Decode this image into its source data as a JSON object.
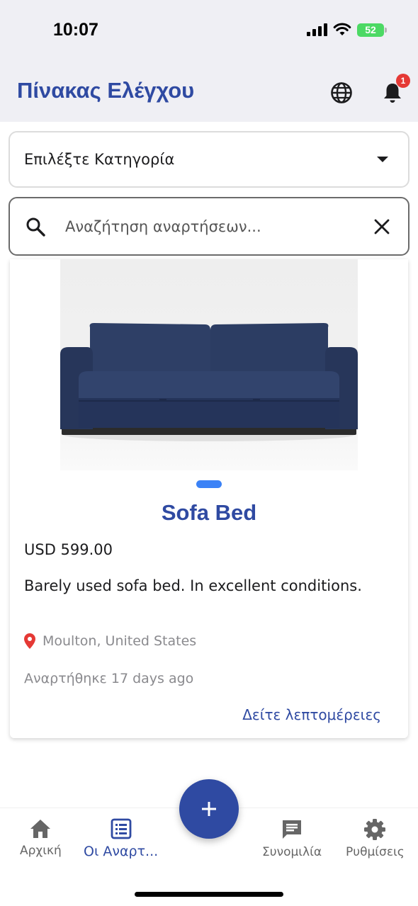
{
  "status_bar": {
    "time": "10:07",
    "battery": "52"
  },
  "header": {
    "title": "Πίνακας Ελέγχου",
    "notification_count": "1"
  },
  "filters": {
    "category_placeholder": "Επιλέξτε Κατηγορία",
    "search_placeholder": "Αναζήτηση αναρτήσεων..."
  },
  "listing": {
    "title": "Sofa Bed",
    "price": "USD 599.00",
    "description": "Barely used sofa bed. In excellent conditions.",
    "location": "Moulton, United States",
    "posted": "Αναρτήθηκε 17 days ago",
    "details_label": "Δείτε λεπτομέρειες",
    "image_count": 1
  },
  "bottom_nav": {
    "items": [
      {
        "label": "Αρχική",
        "icon": "home-icon"
      },
      {
        "label": "Οι Αναρτ...",
        "icon": "list-icon",
        "active": true
      },
      {
        "label": "Συνομιλία",
        "icon": "chat-icon"
      },
      {
        "label": "Ρυθμίσεις",
        "icon": "settings-icon"
      }
    ],
    "fab_icon": "plus-icon"
  },
  "colors": {
    "accent": "#2f4aa2",
    "badge": "#e53935",
    "indicator": "#3b82f6",
    "location_pin": "#e53935"
  }
}
